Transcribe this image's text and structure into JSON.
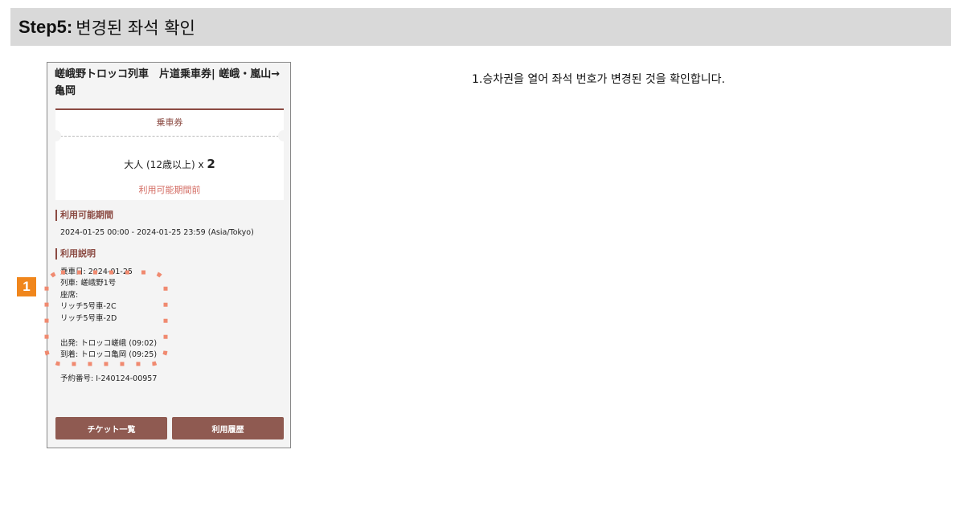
{
  "header": {
    "step": "Step5:",
    "title": "변경된 좌석 확인"
  },
  "ticket": {
    "title": "嵯峨野トロッコ列車　片道乗車券| 嵯峨・嵐山→亀岡",
    "card_head": "乗車券",
    "passenger_label": "大人 (12歳以上) x ",
    "passenger_count": "2",
    "status": "利用可能期間前"
  },
  "validity": {
    "heading": "利用可能期間",
    "value": "2024-01-25 00:00 - 2024-01-25 23:59 (Asia/Tokyo)"
  },
  "usage": {
    "heading": "利用説明",
    "lines": [
      "乗車日: 2024-01-25",
      "列車: 嵯峨野1号",
      "座席:",
      "リッチ5号車-2C",
      "リッチ5号車-2D"
    ],
    "departure": "出発: トロッコ嵯峨 (09:02)",
    "arrival": "到着: トロッコ亀岡 (09:25)",
    "reservation": "予約番号: I-240124-00957"
  },
  "buttons": {
    "ticket_list": "チケット一覧",
    "history": "利用履歴"
  },
  "callout": {
    "badge": "1",
    "color": "#f0861c",
    "dots_color": "#f08a70"
  },
  "instruction": "1.승차권을 열어 좌석 번호가 변경된 것을 확인합니다."
}
